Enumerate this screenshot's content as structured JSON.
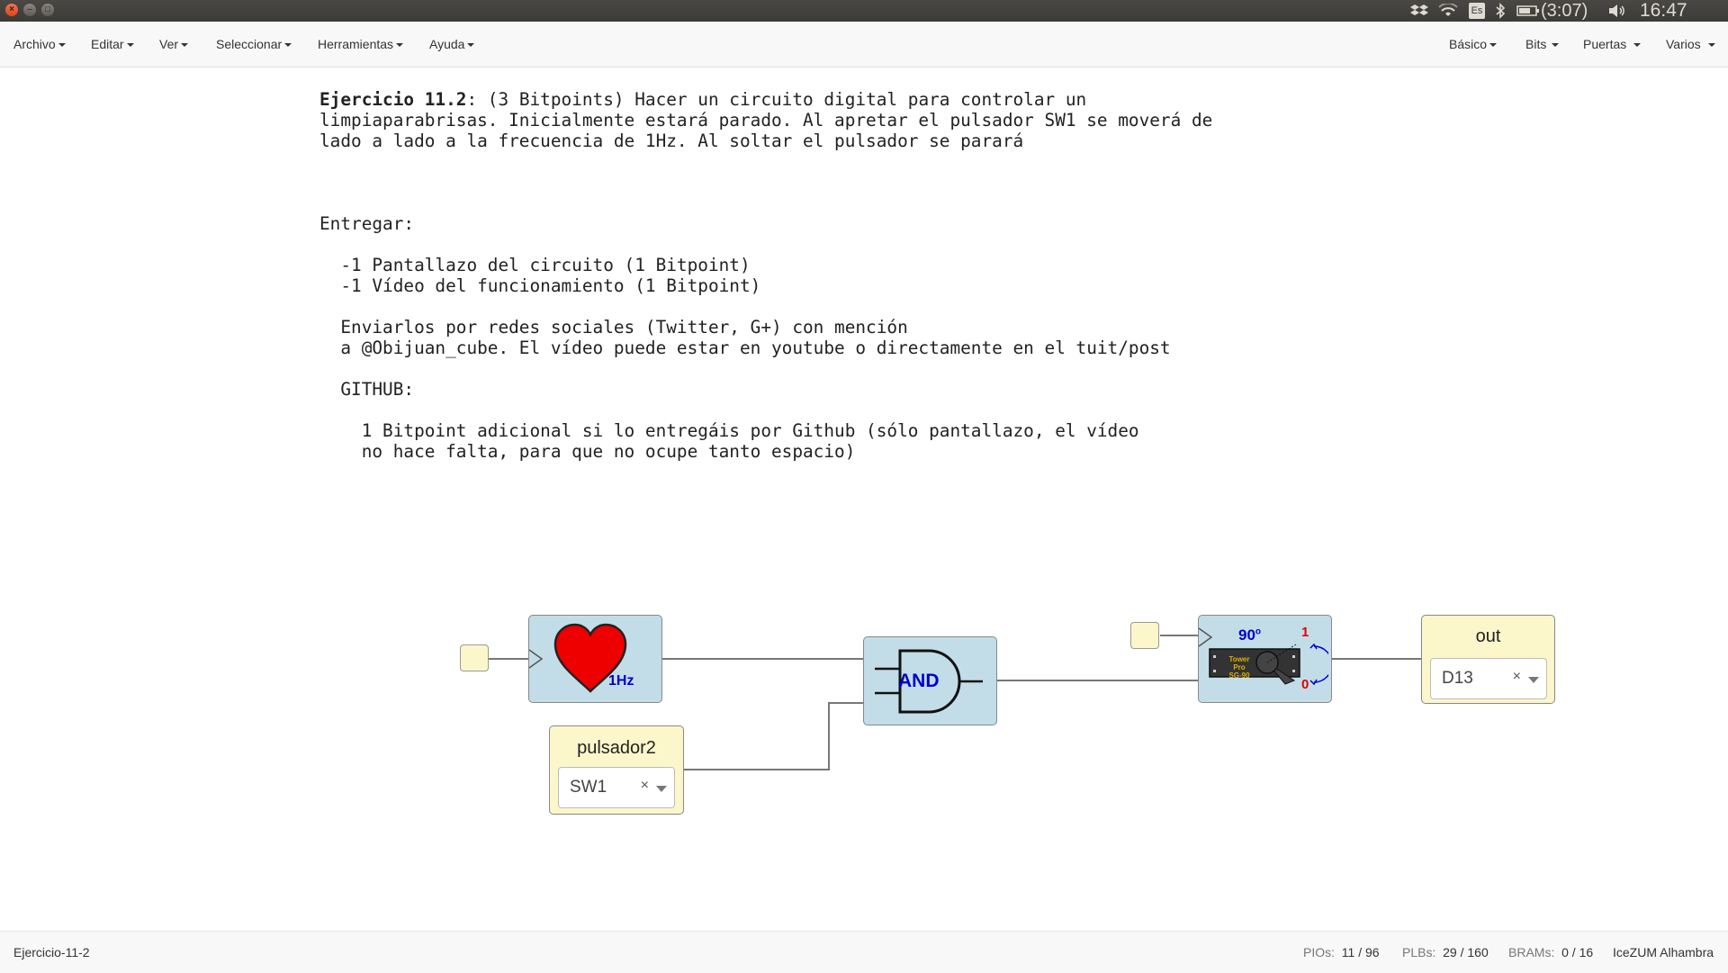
{
  "system_tray": {
    "dropbox_icon": "dropbox-icon",
    "wifi_icon": "wifi-icon",
    "keyboard_layout": "Es",
    "bluetooth_icon": "bluetooth-icon",
    "battery_text": "(3:07)",
    "volume_icon": "volume-icon",
    "clock": "16:47"
  },
  "menubar": {
    "left": [
      "Archivo",
      "Editar",
      "Ver",
      "Seleccionar",
      "Herramientas",
      "Ayuda"
    ],
    "right": [
      "Básico",
      "Bits",
      "Puertas",
      "Varios"
    ]
  },
  "exercise": {
    "title": "Ejercicio 11.2",
    "line1_rest": ": (3 Bitpoints) Hacer un circuito digital para controlar un",
    "line2": "limpiaparabrisas. Inicialmente estará parado. Al apretar el pulsador SW1 se moverá de",
    "line3": "lado a lado a la frecuencia de 1Hz. Al soltar el pulsador se parará",
    "entregar": "Entregar:",
    "item1": "  -1 Pantallazo del circuito (1 Bitpoint)",
    "item2": "  -1 Vídeo del funcionamiento (1 Bitpoint)",
    "send1": "  Enviarlos por redes sociales (Twitter, G+) con mención",
    "send2": "  a @Obijuan_cube. El vídeo puede estar en youtube o directamente en el tuit/post",
    "github": "  GITHUB:",
    "gh1": "    1 Bitpoint adicional si lo entregáis por Github (sólo pantallazo, el vídeo",
    "gh2": "    no hace falta, para que no ocupe tanto espacio)"
  },
  "diagram": {
    "heart_block": {
      "freq_label": "1Hz"
    },
    "and_gate": {
      "label": "AND"
    },
    "input_block": {
      "name": "pulsador2",
      "pin": "SW1"
    },
    "servo_block": {
      "angle_label": "90",
      "angle_sup": "o",
      "pos_one": "1",
      "pos_zero": "0",
      "brand_line1": "Tower",
      "brand_line2": "Pro",
      "brand_line3": "SG-90"
    },
    "output_block": {
      "name": "out",
      "pin": "D13"
    },
    "clear_symbol": "×"
  },
  "statusbar": {
    "filename": "Ejercicio-11-2",
    "pios_label": "PIOs:",
    "pios_value": "11 / 96",
    "plbs_label": "PLBs:",
    "plbs_value": "29 / 160",
    "brams_label": "BRAMs:",
    "brams_value": "0 / 16",
    "board": "IceZUM Alhambra"
  },
  "colors": {
    "block_blue": "#c3dde8",
    "block_yellow": "#fbf7ca",
    "heart_red": "#ee0000",
    "label_blue": "#0000cc"
  }
}
